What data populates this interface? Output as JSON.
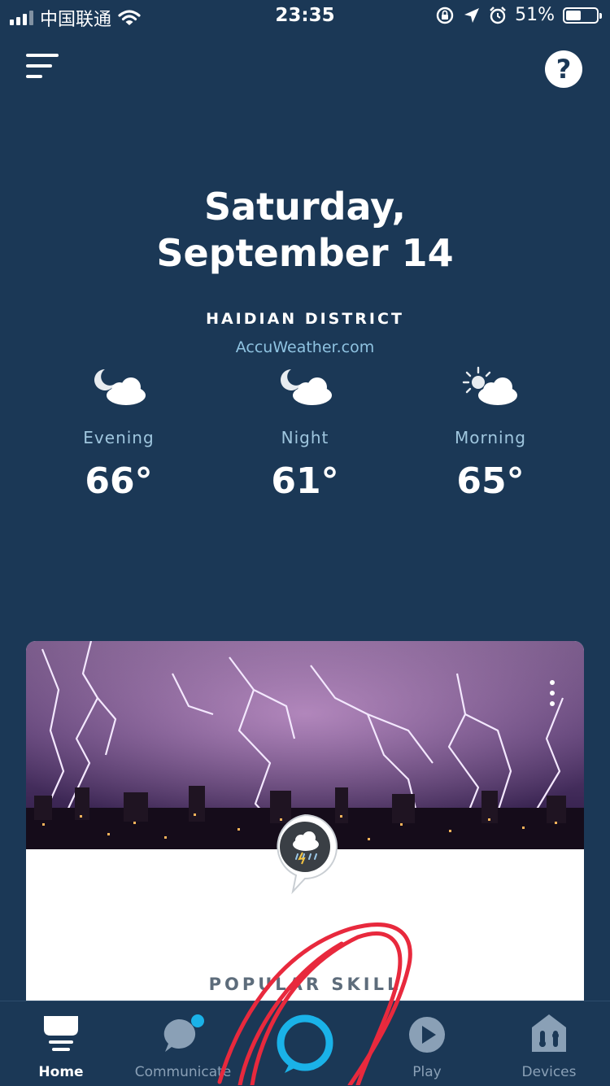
{
  "status_bar": {
    "carrier": "中国联通",
    "time": "23:35",
    "battery_percent": "51%",
    "battery_level": 0.51,
    "icons": [
      "signal-icon",
      "wifi-icon",
      "rotation-lock-icon",
      "location-arrow-icon",
      "alarm-icon",
      "battery-icon"
    ]
  },
  "header": {
    "menu_icon": "hamburger-menu-icon",
    "help_label": "?"
  },
  "date": {
    "line1": "Saturday,",
    "line2": "September 14"
  },
  "weather": {
    "location": "HAIDIAN DISTRICT",
    "source": "AccuWeather.com",
    "forecast": [
      {
        "label": "Evening",
        "temp": "66°",
        "icon": "moon-cloud-icon"
      },
      {
        "label": "Night",
        "temp": "61°",
        "icon": "moon-cloud-icon"
      },
      {
        "label": "Morning",
        "temp": "65°",
        "icon": "sun-cloud-icon"
      }
    ]
  },
  "card": {
    "image": "lightning-storm-city-image",
    "badge_icon": "weather-skill-icon",
    "label": "POPULAR SKILL"
  },
  "nav": {
    "items": [
      {
        "label": "Home",
        "icon": "home-icon",
        "active": true
      },
      {
        "label": "Communicate",
        "icon": "chat-bubble-icon",
        "active": false
      },
      {
        "label": "",
        "icon": "alexa-ring-icon",
        "active": false
      },
      {
        "label": "Play",
        "icon": "play-icon",
        "active": false
      },
      {
        "label": "Devices",
        "icon": "devices-house-icon",
        "active": false
      }
    ]
  },
  "colors": {
    "background": "#1b3856",
    "accent": "#1ab2e8",
    "annotation": "#e8293d"
  }
}
